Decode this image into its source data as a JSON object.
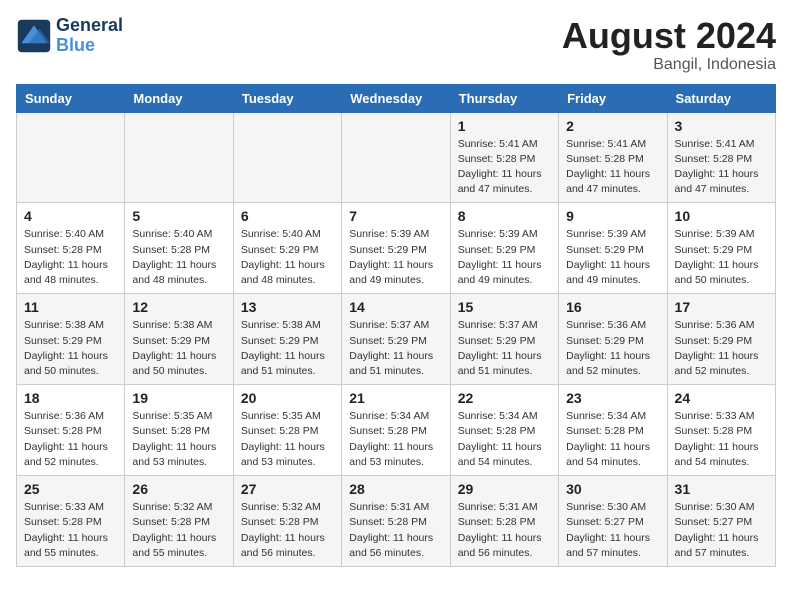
{
  "header": {
    "logo_line1": "General",
    "logo_line2": "Blue",
    "month_year": "August 2024",
    "location": "Bangil, Indonesia"
  },
  "weekdays": [
    "Sunday",
    "Monday",
    "Tuesday",
    "Wednesday",
    "Thursday",
    "Friday",
    "Saturday"
  ],
  "weeks": [
    [
      {
        "day": "",
        "sunrise": "",
        "sunset": "",
        "daylight": ""
      },
      {
        "day": "",
        "sunrise": "",
        "sunset": "",
        "daylight": ""
      },
      {
        "day": "",
        "sunrise": "",
        "sunset": "",
        "daylight": ""
      },
      {
        "day": "",
        "sunrise": "",
        "sunset": "",
        "daylight": ""
      },
      {
        "day": "1",
        "sunrise": "Sunrise: 5:41 AM",
        "sunset": "Sunset: 5:28 PM",
        "daylight": "Daylight: 11 hours and 47 minutes."
      },
      {
        "day": "2",
        "sunrise": "Sunrise: 5:41 AM",
        "sunset": "Sunset: 5:28 PM",
        "daylight": "Daylight: 11 hours and 47 minutes."
      },
      {
        "day": "3",
        "sunrise": "Sunrise: 5:41 AM",
        "sunset": "Sunset: 5:28 PM",
        "daylight": "Daylight: 11 hours and 47 minutes."
      }
    ],
    [
      {
        "day": "4",
        "sunrise": "Sunrise: 5:40 AM",
        "sunset": "Sunset: 5:28 PM",
        "daylight": "Daylight: 11 hours and 48 minutes."
      },
      {
        "day": "5",
        "sunrise": "Sunrise: 5:40 AM",
        "sunset": "Sunset: 5:28 PM",
        "daylight": "Daylight: 11 hours and 48 minutes."
      },
      {
        "day": "6",
        "sunrise": "Sunrise: 5:40 AM",
        "sunset": "Sunset: 5:29 PM",
        "daylight": "Daylight: 11 hours and 48 minutes."
      },
      {
        "day": "7",
        "sunrise": "Sunrise: 5:39 AM",
        "sunset": "Sunset: 5:29 PM",
        "daylight": "Daylight: 11 hours and 49 minutes."
      },
      {
        "day": "8",
        "sunrise": "Sunrise: 5:39 AM",
        "sunset": "Sunset: 5:29 PM",
        "daylight": "Daylight: 11 hours and 49 minutes."
      },
      {
        "day": "9",
        "sunrise": "Sunrise: 5:39 AM",
        "sunset": "Sunset: 5:29 PM",
        "daylight": "Daylight: 11 hours and 49 minutes."
      },
      {
        "day": "10",
        "sunrise": "Sunrise: 5:39 AM",
        "sunset": "Sunset: 5:29 PM",
        "daylight": "Daylight: 11 hours and 50 minutes."
      }
    ],
    [
      {
        "day": "11",
        "sunrise": "Sunrise: 5:38 AM",
        "sunset": "Sunset: 5:29 PM",
        "daylight": "Daylight: 11 hours and 50 minutes."
      },
      {
        "day": "12",
        "sunrise": "Sunrise: 5:38 AM",
        "sunset": "Sunset: 5:29 PM",
        "daylight": "Daylight: 11 hours and 50 minutes."
      },
      {
        "day": "13",
        "sunrise": "Sunrise: 5:38 AM",
        "sunset": "Sunset: 5:29 PM",
        "daylight": "Daylight: 11 hours and 51 minutes."
      },
      {
        "day": "14",
        "sunrise": "Sunrise: 5:37 AM",
        "sunset": "Sunset: 5:29 PM",
        "daylight": "Daylight: 11 hours and 51 minutes."
      },
      {
        "day": "15",
        "sunrise": "Sunrise: 5:37 AM",
        "sunset": "Sunset: 5:29 PM",
        "daylight": "Daylight: 11 hours and 51 minutes."
      },
      {
        "day": "16",
        "sunrise": "Sunrise: 5:36 AM",
        "sunset": "Sunset: 5:29 PM",
        "daylight": "Daylight: 11 hours and 52 minutes."
      },
      {
        "day": "17",
        "sunrise": "Sunrise: 5:36 AM",
        "sunset": "Sunset: 5:29 PM",
        "daylight": "Daylight: 11 hours and 52 minutes."
      }
    ],
    [
      {
        "day": "18",
        "sunrise": "Sunrise: 5:36 AM",
        "sunset": "Sunset: 5:28 PM",
        "daylight": "Daylight: 11 hours and 52 minutes."
      },
      {
        "day": "19",
        "sunrise": "Sunrise: 5:35 AM",
        "sunset": "Sunset: 5:28 PM",
        "daylight": "Daylight: 11 hours and 53 minutes."
      },
      {
        "day": "20",
        "sunrise": "Sunrise: 5:35 AM",
        "sunset": "Sunset: 5:28 PM",
        "daylight": "Daylight: 11 hours and 53 minutes."
      },
      {
        "day": "21",
        "sunrise": "Sunrise: 5:34 AM",
        "sunset": "Sunset: 5:28 PM",
        "daylight": "Daylight: 11 hours and 53 minutes."
      },
      {
        "day": "22",
        "sunrise": "Sunrise: 5:34 AM",
        "sunset": "Sunset: 5:28 PM",
        "daylight": "Daylight: 11 hours and 54 minutes."
      },
      {
        "day": "23",
        "sunrise": "Sunrise: 5:34 AM",
        "sunset": "Sunset: 5:28 PM",
        "daylight": "Daylight: 11 hours and 54 minutes."
      },
      {
        "day": "24",
        "sunrise": "Sunrise: 5:33 AM",
        "sunset": "Sunset: 5:28 PM",
        "daylight": "Daylight: 11 hours and 54 minutes."
      }
    ],
    [
      {
        "day": "25",
        "sunrise": "Sunrise: 5:33 AM",
        "sunset": "Sunset: 5:28 PM",
        "daylight": "Daylight: 11 hours and 55 minutes."
      },
      {
        "day": "26",
        "sunrise": "Sunrise: 5:32 AM",
        "sunset": "Sunset: 5:28 PM",
        "daylight": "Daylight: 11 hours and 55 minutes."
      },
      {
        "day": "27",
        "sunrise": "Sunrise: 5:32 AM",
        "sunset": "Sunset: 5:28 PM",
        "daylight": "Daylight: 11 hours and 56 minutes."
      },
      {
        "day": "28",
        "sunrise": "Sunrise: 5:31 AM",
        "sunset": "Sunset: 5:28 PM",
        "daylight": "Daylight: 11 hours and 56 minutes."
      },
      {
        "day": "29",
        "sunrise": "Sunrise: 5:31 AM",
        "sunset": "Sunset: 5:28 PM",
        "daylight": "Daylight: 11 hours and 56 minutes."
      },
      {
        "day": "30",
        "sunrise": "Sunrise: 5:30 AM",
        "sunset": "Sunset: 5:27 PM",
        "daylight": "Daylight: 11 hours and 57 minutes."
      },
      {
        "day": "31",
        "sunrise": "Sunrise: 5:30 AM",
        "sunset": "Sunset: 5:27 PM",
        "daylight": "Daylight: 11 hours and 57 minutes."
      }
    ]
  ]
}
